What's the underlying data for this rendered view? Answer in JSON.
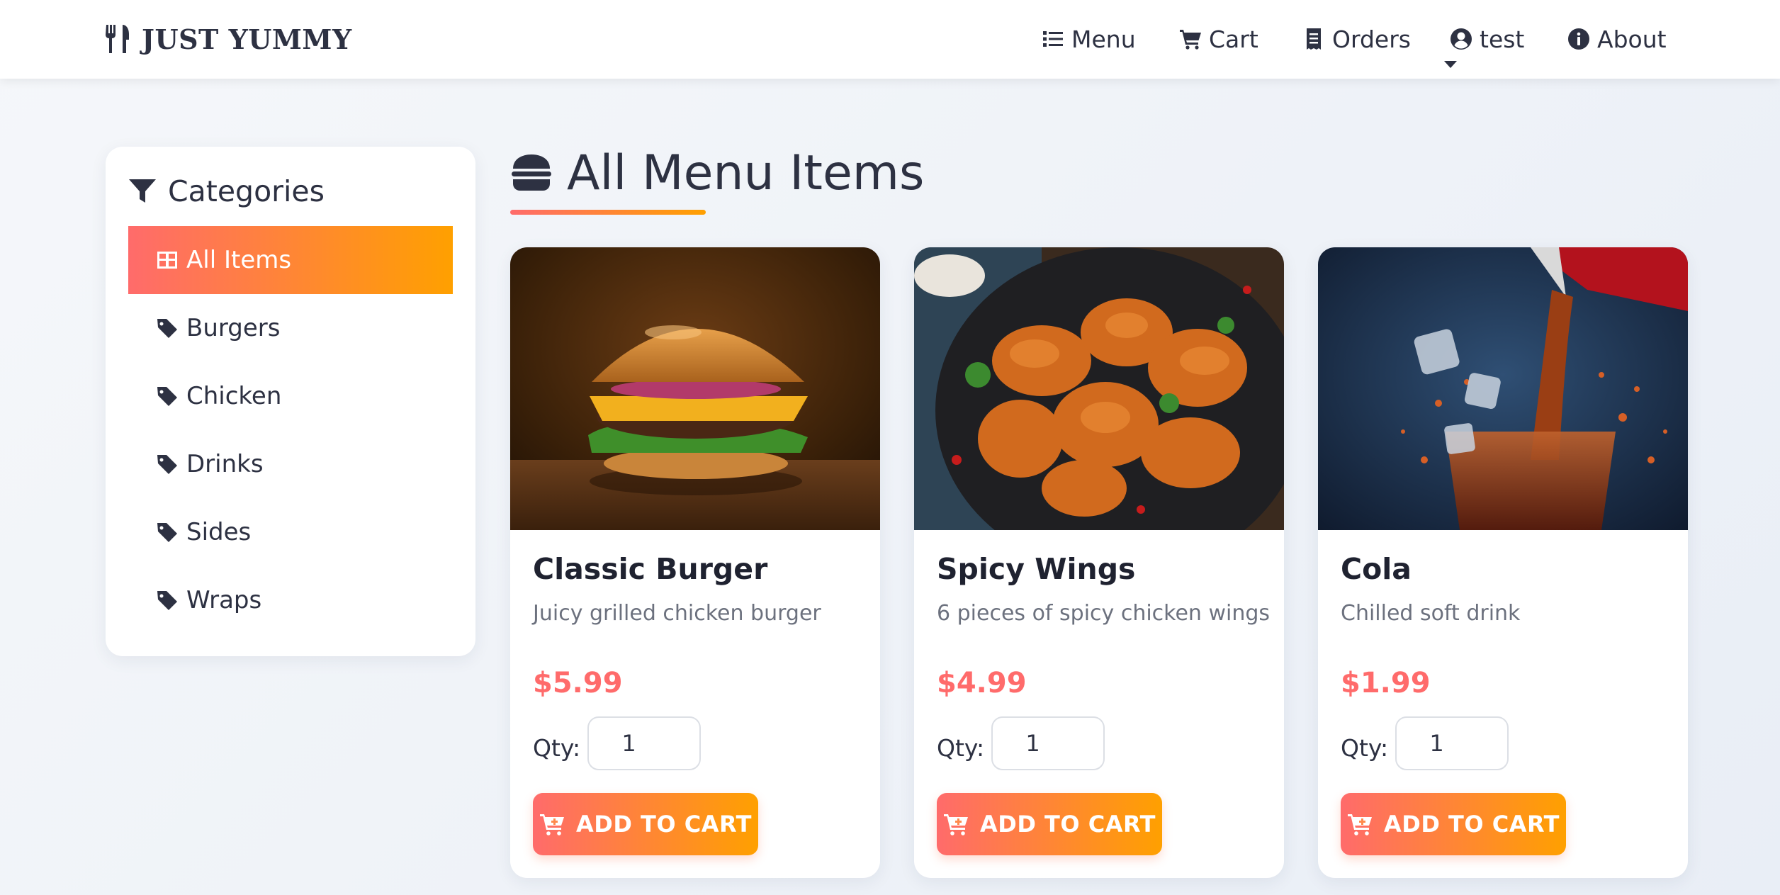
{
  "brand": {
    "name": "JUST YUMMY",
    "icon": "utensils-icon"
  },
  "nav": {
    "items": [
      {
        "label": "Menu",
        "icon": "list-icon"
      },
      {
        "label": "Cart",
        "icon": "cart-icon"
      },
      {
        "label": "Orders",
        "icon": "receipt-icon"
      },
      {
        "label": "test",
        "icon": "user-circle-icon",
        "dropdown": true
      },
      {
        "label": "About",
        "icon": "info-circle-icon"
      }
    ]
  },
  "sidebar": {
    "title": "Categories",
    "title_icon": "filter-icon",
    "items": [
      {
        "label": "All Items",
        "icon": "grid-icon",
        "active": true
      },
      {
        "label": "Burgers",
        "icon": "tag-icon"
      },
      {
        "label": "Chicken",
        "icon": "tag-icon"
      },
      {
        "label": "Drinks",
        "icon": "tag-icon"
      },
      {
        "label": "Sides",
        "icon": "tag-icon"
      },
      {
        "label": "Wraps",
        "icon": "tag-icon"
      }
    ]
  },
  "main": {
    "title": "All Menu Items",
    "title_icon": "burger-icon",
    "products": [
      {
        "name": "Classic Burger",
        "description": "Juicy grilled chicken burger",
        "price": "$5.99",
        "qty_label": "Qty:",
        "qty": "1",
        "button": "ADD TO CART",
        "image": "burger-photo"
      },
      {
        "name": "Spicy Wings",
        "description": "6 pieces of spicy chicken wings",
        "price": "$4.99",
        "qty_label": "Qty:",
        "qty": "1",
        "button": "ADD TO CART",
        "image": "wings-photo"
      },
      {
        "name": "Cola",
        "description": "Chilled soft drink",
        "price": "$1.99",
        "qty_label": "Qty:",
        "qty": "1",
        "button": "ADD TO CART",
        "image": "cola-photo"
      }
    ]
  },
  "colors": {
    "accent_start": "#ff6b6b",
    "accent_end": "#ffa000",
    "price": "#ff6b6b",
    "text": "#2d3142"
  }
}
